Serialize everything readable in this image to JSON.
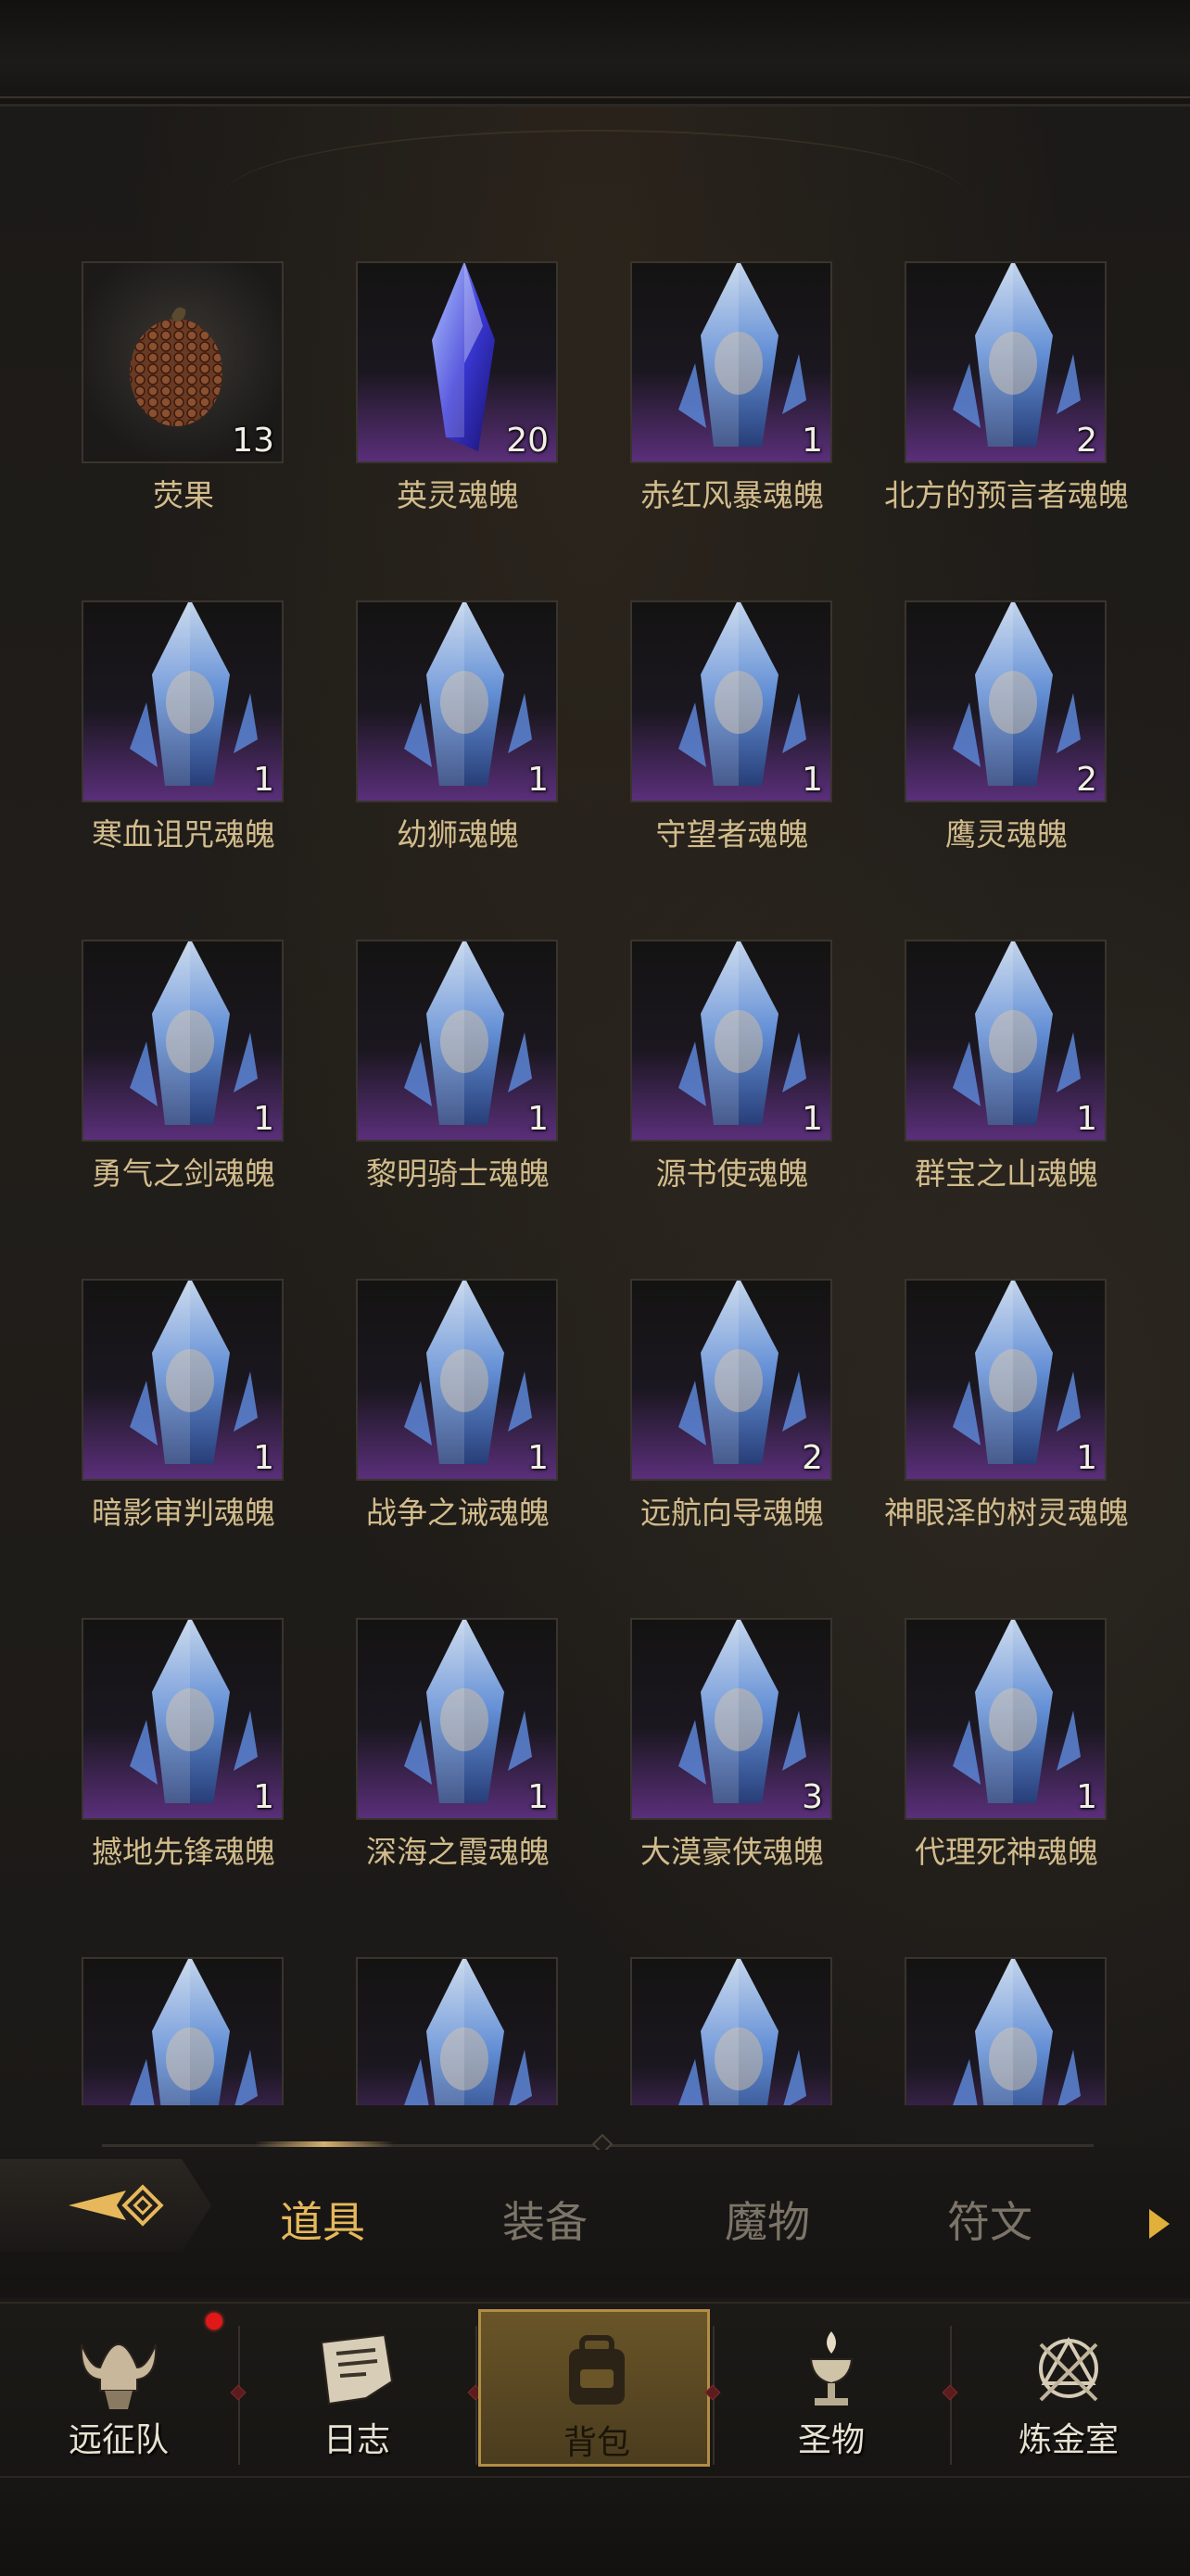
{
  "items": [
    {
      "name": "荧果",
      "count": "13",
      "icon": "seed-pod-icon",
      "art": "plain"
    },
    {
      "name": "英灵魂魄",
      "count": "20",
      "icon": "purple-crystal-icon",
      "art": "crystal"
    },
    {
      "name": "赤红风暴魂魄",
      "count": "1",
      "icon": "soul-crystal-icon",
      "art": "soul"
    },
    {
      "name": "北方的预言者魂魄",
      "count": "2",
      "icon": "soul-crystal-icon",
      "art": "soul"
    },
    {
      "name": "寒血诅咒魂魄",
      "count": "1",
      "icon": "soul-crystal-icon",
      "art": "soul"
    },
    {
      "name": "幼狮魂魄",
      "count": "1",
      "icon": "soul-crystal-icon",
      "art": "soul"
    },
    {
      "name": "守望者魂魄",
      "count": "1",
      "icon": "soul-crystal-icon",
      "art": "soul"
    },
    {
      "name": "鹰灵魂魄",
      "count": "2",
      "icon": "soul-crystal-icon",
      "art": "soul"
    },
    {
      "name": "勇气之剑魂魄",
      "count": "1",
      "icon": "soul-crystal-icon",
      "art": "soul"
    },
    {
      "name": "黎明骑士魂魄",
      "count": "1",
      "icon": "soul-crystal-icon",
      "art": "soul"
    },
    {
      "name": "源书使魂魄",
      "count": "1",
      "icon": "soul-crystal-icon",
      "art": "soul"
    },
    {
      "name": "群宝之山魂魄",
      "count": "1",
      "icon": "soul-crystal-icon",
      "art": "soul"
    },
    {
      "name": "暗影审判魂魄",
      "count": "1",
      "icon": "soul-crystal-icon",
      "art": "soul"
    },
    {
      "name": "战争之诫魂魄",
      "count": "1",
      "icon": "soul-crystal-icon",
      "art": "soul"
    },
    {
      "name": "远航向导魂魄",
      "count": "2",
      "icon": "soul-crystal-icon",
      "art": "soul"
    },
    {
      "name": "神眼泽的树灵魂魄",
      "count": "1",
      "icon": "soul-crystal-icon",
      "art": "soul"
    },
    {
      "name": "撼地先锋魂魄",
      "count": "1",
      "icon": "soul-crystal-icon",
      "art": "soul"
    },
    {
      "name": "深海之霞魂魄",
      "count": "1",
      "icon": "soul-crystal-icon",
      "art": "soul"
    },
    {
      "name": "大漠豪侠魂魄",
      "count": "3",
      "icon": "soul-crystal-icon",
      "art": "soul"
    },
    {
      "name": "代理死神魂魄",
      "count": "1",
      "icon": "soul-crystal-icon",
      "art": "soul"
    },
    {
      "name": "",
      "count": "",
      "icon": "soul-crystal-icon",
      "art": "soul"
    },
    {
      "name": "",
      "count": "",
      "icon": "soul-crystal-icon",
      "art": "soul"
    },
    {
      "name": "",
      "count": "",
      "icon": "soul-crystal-icon",
      "art": "soul"
    },
    {
      "name": "",
      "count": "",
      "icon": "soul-crystal-icon",
      "art": "soul"
    }
  ],
  "tabs": {
    "back_icon": "back-arrow-icon",
    "labels": [
      "道具",
      "装备",
      "魔物",
      "符文"
    ],
    "active_index": 0,
    "next_icon": "next-arrow-icon"
  },
  "nav": {
    "items": [
      {
        "label": "远征队",
        "icon": "viking-helmet-icon",
        "badge": true
      },
      {
        "label": "日志",
        "icon": "scroll-log-icon",
        "badge": false
      },
      {
        "label": "背包",
        "icon": "backpack-icon",
        "badge": false
      },
      {
        "label": "圣物",
        "icon": "relic-chalice-icon",
        "badge": false
      },
      {
        "label": "炼金室",
        "icon": "alchemy-icon",
        "badge": false
      }
    ],
    "active_index": 2
  },
  "colors": {
    "accent_gold": "#e7b85b",
    "tile_purple": "#5a2f7a",
    "label_text": "#d2bc8c",
    "badge_red": "#e01818"
  }
}
